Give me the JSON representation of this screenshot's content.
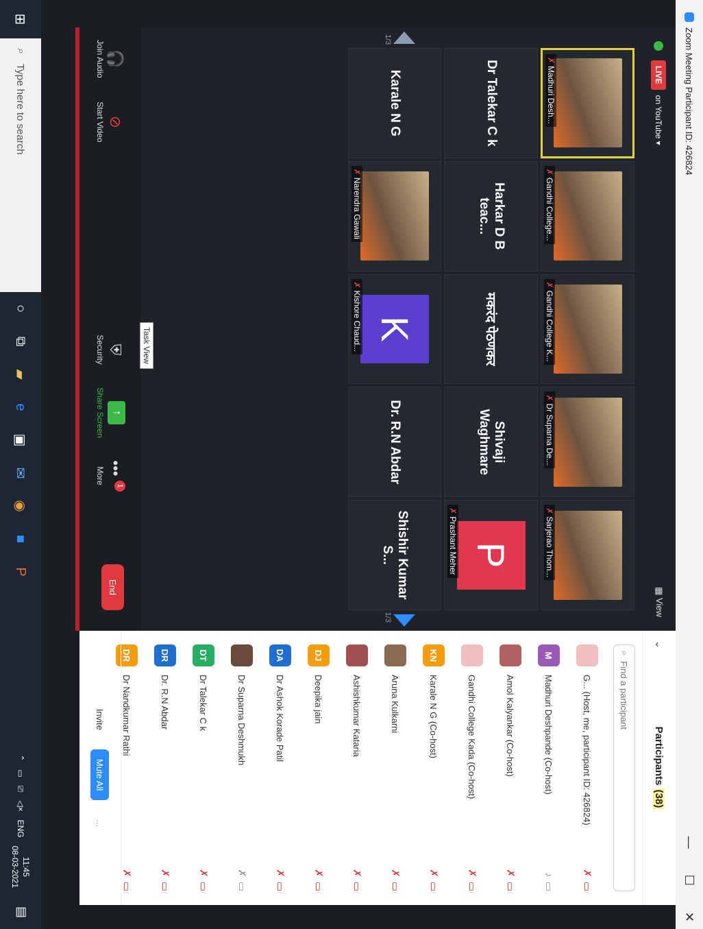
{
  "window": {
    "title": "Zoom Meeting Participant ID: 426824",
    "min": "—",
    "max": "☐",
    "close": "✕"
  },
  "meeting": {
    "live_label": "LIVE",
    "youtube_label": "on YouTube ▾",
    "view_label": "View",
    "page_left": "1/3",
    "page_right": "1/3"
  },
  "tiles": [
    {
      "name": "Madhuri Desh...",
      "type": "video"
    },
    {
      "name": "Gandhi College...",
      "type": "video"
    },
    {
      "name": "Gandhi College K...",
      "type": "video"
    },
    {
      "name": "Dr Suparna De...",
      "type": "video"
    },
    {
      "name": "Sarjerao Thom...",
      "type": "video"
    },
    {
      "name": "Dr Talekar C k",
      "type": "name"
    },
    {
      "name": "Harkar D B teac...",
      "type": "name"
    },
    {
      "name": "मकरंद पेठणकर",
      "type": "name"
    },
    {
      "name": "Shivaji Waghmare",
      "type": "name"
    },
    {
      "name": "Prashant Meher",
      "type": "letter",
      "letter": "P",
      "color": "#e0394f"
    },
    {
      "name": "Karale N G",
      "type": "name"
    },
    {
      "name": "Narendra Gawali",
      "type": "video"
    },
    {
      "name": "Kishore Chaud...",
      "type": "letter",
      "letter": "K",
      "color": "#5a3fd1"
    },
    {
      "name": "Dr. R.N Abdar",
      "type": "name"
    },
    {
      "name": "Shishir Kumar S...",
      "type": "name"
    }
  ],
  "toolbar": {
    "join_audio": "Join Audio",
    "start_video": "Start Video",
    "security": "Security",
    "share_screen": "Share Screen",
    "more": "More",
    "more_badge": "1",
    "end": "End",
    "task_view_tooltip": "Task View"
  },
  "participants": {
    "title": "Participants",
    "count": "(38)",
    "search_placeholder": "Find a participant",
    "list": [
      {
        "name": "G... (Host, me, participant ID: 426824)",
        "initials": "",
        "color": "#f0c0c0",
        "muted": true,
        "grey": false
      },
      {
        "name": "Madhuri Deshpande (Co-host)",
        "initials": "M",
        "color": "#9b59b6",
        "muted": false,
        "grey": true
      },
      {
        "name": "Amol Kalyankar (Co-host)",
        "initials": "",
        "color": "#b06060",
        "muted": true,
        "grey": false
      },
      {
        "name": "Gandhi College Kada (Co-host)",
        "initials": "",
        "color": "#f0c0c0",
        "muted": true,
        "grey": false
      },
      {
        "name": "Karale N G (Co-host)",
        "initials": "KN",
        "color": "#f39c12",
        "muted": true,
        "grey": false
      },
      {
        "name": "Aruna Kulkarni",
        "initials": "",
        "color": "#8a6a50",
        "muted": true,
        "grey": false
      },
      {
        "name": "Ashishkumar Kataria",
        "initials": "",
        "color": "#a05050",
        "muted": true,
        "grey": false
      },
      {
        "name": "Deepika jain",
        "initials": "DJ",
        "color": "#f39c12",
        "muted": true,
        "grey": false
      },
      {
        "name": "Dr Ashok Korade Patil",
        "initials": "DA",
        "color": "#1f6fd1",
        "muted": true,
        "grey": false
      },
      {
        "name": "Dr Suparna Deshmukh",
        "initials": "",
        "color": "#6a4a3a",
        "muted": true,
        "grey": true
      },
      {
        "name": "Dr Talekar C k",
        "initials": "DT",
        "color": "#27ae60",
        "muted": true,
        "grey": false
      },
      {
        "name": "Dr. R.N Abdar",
        "initials": "DR",
        "color": "#1f6fd1",
        "muted": true,
        "grey": false
      },
      {
        "name": "Dr Nandkumar Rathi",
        "initials": "DR",
        "color": "#f39c12",
        "muted": true,
        "grey": false
      }
    ],
    "invite": "Invite",
    "mute_all": "Mute All",
    "more": "..."
  },
  "taskbar": {
    "search_placeholder": "Type here to search",
    "lang": "ENG",
    "time": "11:45",
    "date": "08-03-2021"
  }
}
